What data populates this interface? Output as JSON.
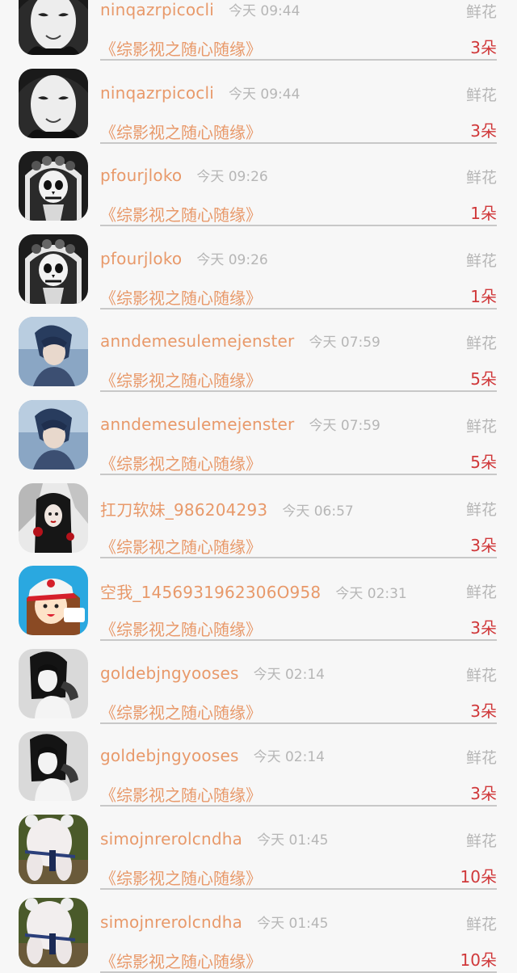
{
  "records": [
    {
      "username": "ninqazrpicocli",
      "time": "今天 09:44",
      "gift_type": "鲜花",
      "work_title": "《综影视之随心随缘》",
      "count": "3朵",
      "avatar_icon": "white-mask-avatar-icon"
    },
    {
      "username": "ninqazrpicocli",
      "time": "今天 09:44",
      "gift_type": "鲜花",
      "work_title": "《综影视之随心随缘》",
      "count": "3朵",
      "avatar_icon": "white-mask-avatar-icon"
    },
    {
      "username": "pfourjloko",
      "time": "今天 09:26",
      "gift_type": "鲜花",
      "work_title": "《综影视之随心随缘》",
      "count": "1朵",
      "avatar_icon": "skull-bride-avatar-icon"
    },
    {
      "username": "pfourjloko",
      "time": "今天 09:26",
      "gift_type": "鲜花",
      "work_title": "《综影视之随心随缘》",
      "count": "1朵",
      "avatar_icon": "skull-bride-avatar-icon"
    },
    {
      "username": "anndemesulemejenster",
      "time": "今天 07:59",
      "gift_type": "鲜花",
      "work_title": "《综影视之随心随缘》",
      "count": "5朵",
      "avatar_icon": "anime-boy-avatar-icon"
    },
    {
      "username": "anndemesulemejenster",
      "time": "今天 07:59",
      "gift_type": "鲜花",
      "work_title": "《综影视之随心随缘》",
      "count": "5朵",
      "avatar_icon": "anime-boy-avatar-icon"
    },
    {
      "username": "扛刀软妹_986204293",
      "time": "今天 06:57",
      "gift_type": "鲜花",
      "work_title": "《综影视之随心随缘》",
      "count": "3朵",
      "avatar_icon": "dark-art-avatar-icon"
    },
    {
      "username": "空我_1456931962306O958",
      "time": "今天 02:31",
      "gift_type": "鲜花",
      "work_title": "《综影视之随心随缘》",
      "count": "3朵",
      "avatar_icon": "cartoon-girl-cap-avatar-icon"
    },
    {
      "username": "goldebjngyooses",
      "time": "今天 02:14",
      "gift_type": "鲜花",
      "work_title": "《综影视之随心随缘》",
      "count": "3朵",
      "avatar_icon": "bw-girl-avatar-icon"
    },
    {
      "username": "goldebjngyooses",
      "time": "今天 02:14",
      "gift_type": "鲜花",
      "work_title": "《综影视之随心随缘》",
      "count": "3朵",
      "avatar_icon": "bw-girl-avatar-icon"
    },
    {
      "username": "simojnrerolcndha",
      "time": "今天 01:45",
      "gift_type": "鲜花",
      "work_title": "《综影视之随心随缘》",
      "count": "10朵",
      "avatar_icon": "teddy-bear-avatar-icon"
    },
    {
      "username": "simojnrerolcndha",
      "time": "今天 01:45",
      "gift_type": "鲜花",
      "work_title": "《综影视之随心随缘》",
      "count": "10朵",
      "avatar_icon": "teddy-bear-avatar-icon"
    }
  ],
  "colors": {
    "username": "#e8996a",
    "time": "#b6b6b6",
    "count": "#d0383a",
    "divider": "#c8c8c8",
    "background": "#f7f7f7"
  }
}
